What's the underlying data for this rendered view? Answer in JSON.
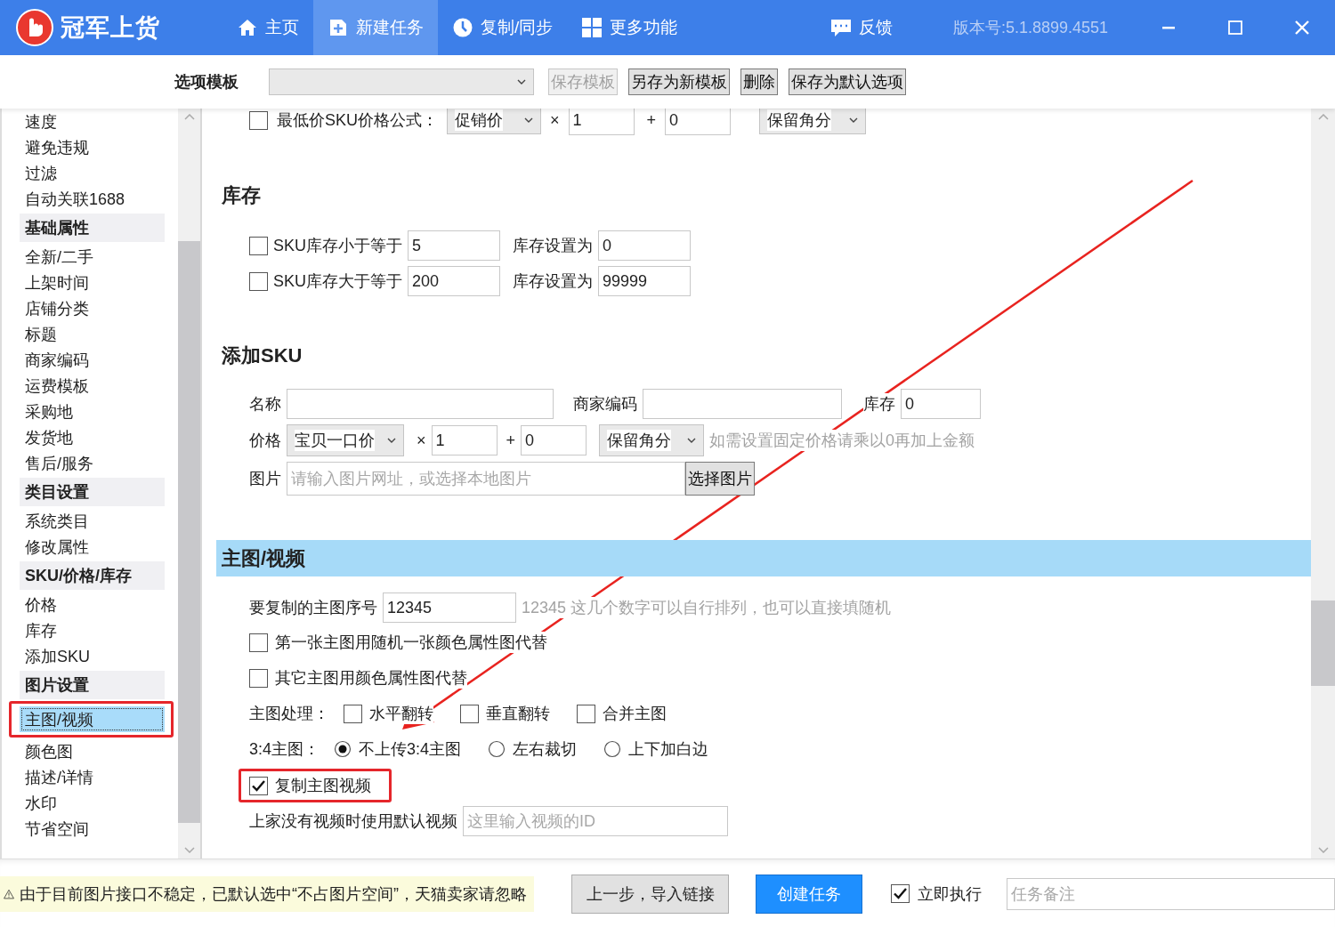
{
  "app": {
    "name": "冠军上货",
    "version": "版本号:5.1.8899.4551"
  },
  "nav": [
    {
      "label": "主页",
      "kind": "home",
      "selected": false
    },
    {
      "label": "新建任务",
      "kind": "new",
      "selected": true
    },
    {
      "label": "复制/同步",
      "kind": "clock",
      "selected": false
    },
    {
      "label": "更多功能",
      "kind": "grid",
      "selected": false
    },
    {
      "label": "反馈",
      "kind": "chat",
      "selected": false
    }
  ],
  "template_bar": {
    "label": "选项模板",
    "buttons": [
      {
        "label": "保存模板",
        "disabled": true
      },
      {
        "label": "另存为新模板",
        "disabled": false
      },
      {
        "label": "删除",
        "disabled": false
      },
      {
        "label": "保存为默认选项",
        "disabled": false
      }
    ]
  },
  "sidebar": {
    "items": [
      {
        "label": "速度",
        "kind": "item",
        "selected": false
      },
      {
        "label": "避免违规",
        "kind": "item",
        "selected": false
      },
      {
        "label": "过滤",
        "kind": "item",
        "selected": false
      },
      {
        "label": "自动关联1688",
        "kind": "item",
        "selected": false
      },
      {
        "label": "基础属性",
        "kind": "header",
        "selected": false
      },
      {
        "label": "全新/二手",
        "kind": "item",
        "selected": false
      },
      {
        "label": "上架时间",
        "kind": "item",
        "selected": false
      },
      {
        "label": "店铺分类",
        "kind": "item",
        "selected": false
      },
      {
        "label": "标题",
        "kind": "item",
        "selected": false
      },
      {
        "label": "商家编码",
        "kind": "item",
        "selected": false
      },
      {
        "label": "运费模板",
        "kind": "item",
        "selected": false
      },
      {
        "label": "采购地",
        "kind": "item",
        "selected": false
      },
      {
        "label": "发货地",
        "kind": "item",
        "selected": false
      },
      {
        "label": "售后/服务",
        "kind": "item",
        "selected": false
      },
      {
        "label": "类目设置",
        "kind": "header",
        "selected": false
      },
      {
        "label": "系统类目",
        "kind": "item",
        "selected": false
      },
      {
        "label": "修改属性",
        "kind": "item",
        "selected": false
      },
      {
        "label": "SKU/价格/库存",
        "kind": "header",
        "selected": false
      },
      {
        "label": "价格",
        "kind": "item",
        "selected": false
      },
      {
        "label": "库存",
        "kind": "item",
        "selected": false
      },
      {
        "label": "添加SKU",
        "kind": "item",
        "selected": false
      },
      {
        "label": "图片设置",
        "kind": "header",
        "selected": false
      },
      {
        "label": "主图/视频",
        "kind": "item",
        "selected": true,
        "highlighted": true
      },
      {
        "label": "颜色图",
        "kind": "item",
        "selected": false
      },
      {
        "label": "描述/详情",
        "kind": "item",
        "selected": false
      },
      {
        "label": "水印",
        "kind": "item",
        "selected": false
      },
      {
        "label": "节省空间",
        "kind": "item",
        "selected": false
      }
    ]
  },
  "price_formula": {
    "checked": false,
    "label": "最低价SKU价格公式：",
    "base": "促销价",
    "times": "×",
    "multiplier": "1",
    "plus": "+",
    "addend": "0",
    "rounding": "保留角分"
  },
  "stock": {
    "title": "库存",
    "rules": [
      {
        "checked": false,
        "label": "SKU库存小于等于",
        "threshold": "5",
        "set_label": "库存设置为",
        "value": "0"
      },
      {
        "checked": false,
        "label": "SKU库存大于等于",
        "threshold": "200",
        "set_label": "库存设置为",
        "value": "99999"
      }
    ]
  },
  "add_sku": {
    "title": "添加SKU",
    "name_label": "名称",
    "code_label": "商家编码",
    "stock_label": "库存",
    "stock": "0",
    "price_label": "价格",
    "price_base": "宝贝一口价",
    "times": "×",
    "multiplier": "1",
    "plus": "+",
    "addend": "0",
    "rounding": "保留角分",
    "hint": "如需设置固定价格请乘以0再加上金额",
    "image_label": "图片",
    "image_placeholder": "请输入图片网址，或选择本地图片",
    "choose_button": "选择图片"
  },
  "main_images": {
    "title": "主图/视频",
    "order_label": "要复制的主图序号",
    "order": "12345",
    "order_hint": "12345 这几个数字可以自行排列，也可以直接填随机",
    "options": [
      {
        "label": "第一张主图用随机一张颜色属性图代替",
        "checked": false
      },
      {
        "label": "其它主图用颜色属性图代替",
        "checked": false
      }
    ],
    "processing_label": "主图处理：",
    "processing": [
      {
        "label": "水平翻转",
        "checked": false
      },
      {
        "label": "垂直翻转",
        "checked": false
      },
      {
        "label": "合并主图",
        "checked": false
      }
    ],
    "ratio_label": "3:4主图：",
    "ratio_options": [
      {
        "label": "不上传3:4主图",
        "selected": true
      },
      {
        "label": "左右裁切",
        "selected": false
      },
      {
        "label": "上下加白边",
        "selected": false
      }
    ],
    "copy_video": {
      "label": "复制主图视频",
      "checked": true,
      "highlighted": true
    },
    "default_video_label": "上家没有视频时使用默认视频",
    "default_video_placeholder": "这里输入视频的ID"
  },
  "footer": {
    "warning": "由于目前图片接口不稳定，已默认选中“不占图片空间”，天猫卖家请忽略",
    "back_button": "上一步，导入链接",
    "create_button": "创建任务",
    "run_now": {
      "label": "立即执行",
      "checked": true
    },
    "note_placeholder": "任务备注"
  }
}
